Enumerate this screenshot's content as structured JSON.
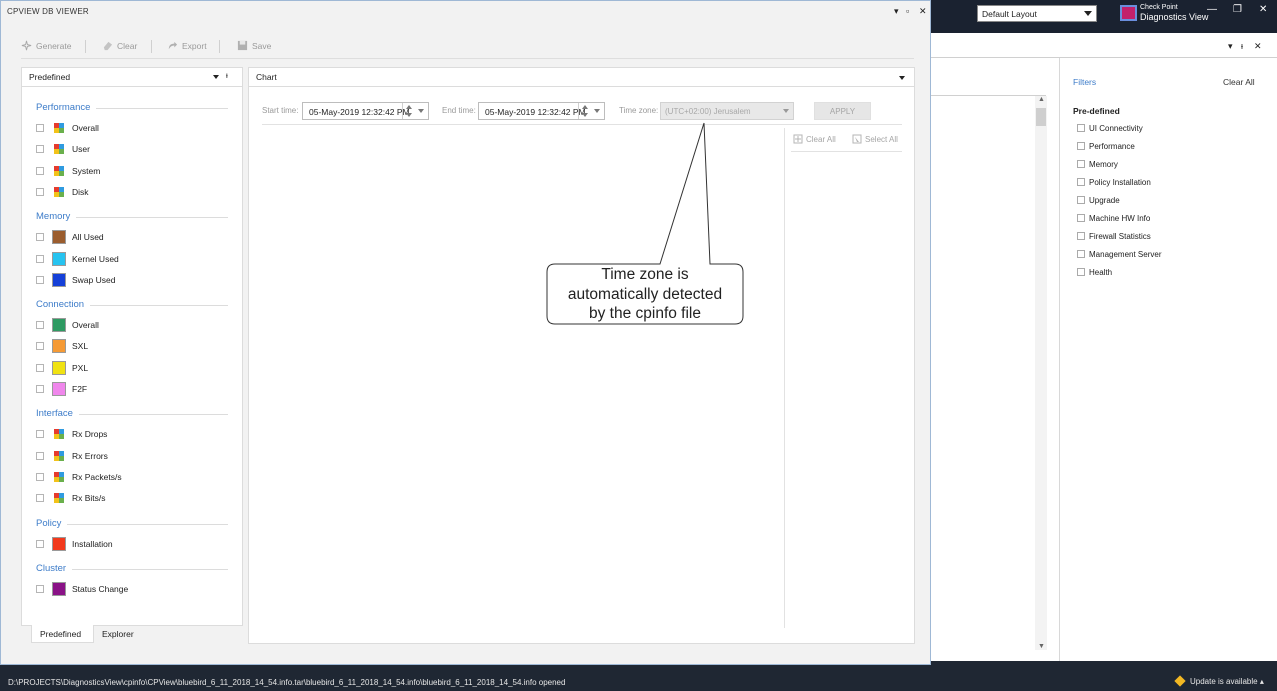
{
  "window": {
    "title": "CPVIEW DB VIEWER",
    "pin": "▾",
    "restore": "▫",
    "close": "✕"
  },
  "toolbar": {
    "generate": "Generate",
    "clear": "Clear",
    "export": "Export",
    "save": "Save"
  },
  "left_panel": {
    "title": "Predefined",
    "groups": [
      {
        "label": "Performance",
        "items": [
          {
            "label": "Overall",
            "swatch": "multi"
          },
          {
            "label": "User",
            "swatch": "multi"
          },
          {
            "label": "System",
            "swatch": "multi"
          },
          {
            "label": "Disk",
            "swatch": "multi"
          }
        ]
      },
      {
        "label": "Memory",
        "items": [
          {
            "label": "All Used",
            "swatch": "#9b5d2e"
          },
          {
            "label": "Kernel Used",
            "swatch": "#26c3f0"
          },
          {
            "label": "Swap Used",
            "swatch": "#1540d8"
          }
        ]
      },
      {
        "label": "Connection",
        "items": [
          {
            "label": "Overall",
            "swatch": "#2e9a62"
          },
          {
            "label": "SXL",
            "swatch": "#f59a35"
          },
          {
            "label": "PXL",
            "swatch": "#f0e212"
          },
          {
            "label": "F2F",
            "swatch": "#f087ec"
          }
        ]
      },
      {
        "label": "Interface",
        "items": [
          {
            "label": "Rx Drops",
            "swatch": "multi"
          },
          {
            "label": "Rx Errors",
            "swatch": "multi"
          },
          {
            "label": "Rx Packets/s",
            "swatch": "multi"
          },
          {
            "label": "Rx Bits/s",
            "swatch": "multi"
          }
        ]
      },
      {
        "label": "Policy",
        "items": [
          {
            "label": "Installation",
            "swatch": "#f2391c"
          }
        ]
      },
      {
        "label": "Cluster",
        "items": [
          {
            "label": "Status Change",
            "swatch": "#8a1287"
          }
        ]
      }
    ],
    "tabs": {
      "predefined": "Predefined",
      "explorer": "Explorer"
    }
  },
  "chart_panel": {
    "title": "Chart",
    "start_label": "Start time:",
    "start_value": "05-May-2019 12:32:42 PM",
    "end_label": "End time:",
    "end_value": "05-May-2019 12:32:42 PM",
    "tz_label": "Time zone:",
    "tz_value": "(UTC+02:00) Jerusalem",
    "apply": "APPLY",
    "clear_all": "Clear All",
    "select_all": "Select All"
  },
  "callout": {
    "line1": "Time zone is",
    "line2": "automatically detected",
    "line3": "by the cpinfo file"
  },
  "main_app": {
    "layout_value": "Default Layout",
    "brand_line1": "Check Point",
    "brand_line2": "Diagnostics View",
    "minimize": "—",
    "restore": "❐",
    "close": "✕",
    "filters_title": "Filters",
    "clear_all": "Clear All",
    "predefined_title": "Pre-defined",
    "filters": [
      "UI Connectivity",
      "Performance",
      "Memory",
      "Policy Installation",
      "Upgrade",
      "Machine HW Info",
      "Firewall Statistics",
      "Management Server",
      "Health"
    ]
  },
  "status_bar": {
    "path": "D:\\PROJECTS\\DiagnosticsView\\cpinfo\\CPView\\bluebird_6_11_2018_14_54.info.tar\\bluebird_6_11_2018_14_54.info\\bluebird_6_11_2018_14_54.info opened",
    "update": "Update is available"
  }
}
